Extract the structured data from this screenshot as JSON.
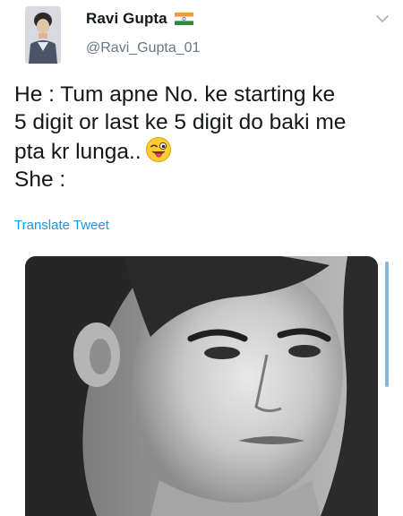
{
  "tweet": {
    "display_name": "Ravi Gupta",
    "name_flag": "india-flag",
    "handle": "@Ravi_Gupta_01",
    "text_lines": [
      "He : Tum apne No. ke starting ke",
      "5 digit or last ke 5 digit do baki me",
      "pta kr lunga..",
      "She :"
    ],
    "emoji": "winking-face-with-tongue",
    "translate_label": "Translate Tweet",
    "media": {
      "kind": "photo"
    }
  },
  "colors": {
    "primary_text": "#14171a",
    "secondary_text": "#657786",
    "link": "#1b95e0"
  },
  "icons": [
    "chevron-down-icon",
    "india-flag-icon",
    "winking-face-with-tongue-emoji"
  ]
}
